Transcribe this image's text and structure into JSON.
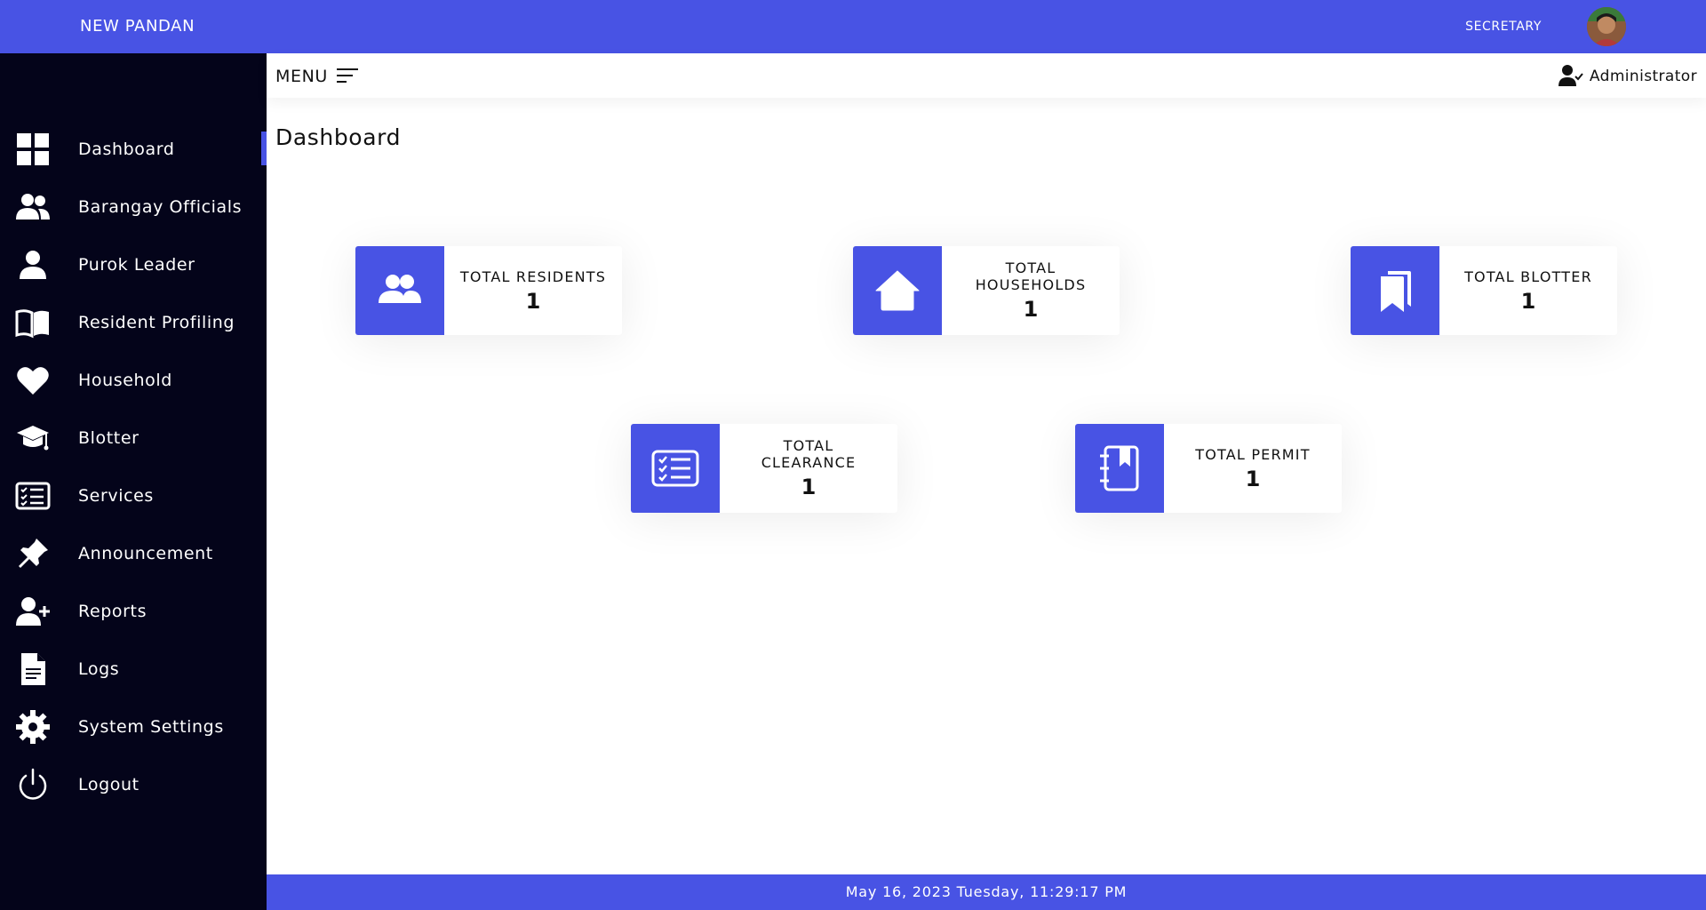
{
  "topbar": {
    "brand": "NEW PANDAN",
    "role": "SECRETARY"
  },
  "sidebar": {
    "items": [
      {
        "label": "Dashboard",
        "icon": "dashboard-grid-icon"
      },
      {
        "label": "Barangay Officials",
        "icon": "users-icon"
      },
      {
        "label": "Purok Leader",
        "icon": "user-icon"
      },
      {
        "label": "Resident Profiling",
        "icon": "book-icon"
      },
      {
        "label": "Household",
        "icon": "heart-icon"
      },
      {
        "label": "Blotter",
        "icon": "graduation-cap-icon"
      },
      {
        "label": "Services",
        "icon": "checklist-icon"
      },
      {
        "label": "Announcement",
        "icon": "pin-icon"
      },
      {
        "label": "Reports",
        "icon": "user-plus-icon"
      },
      {
        "label": "Logs",
        "icon": "file-icon"
      },
      {
        "label": "System Settings",
        "icon": "gear-icon"
      },
      {
        "label": "Logout",
        "icon": "power-icon"
      }
    ],
    "active": "Dashboard"
  },
  "subheader": {
    "menu_label": "MENU",
    "user_label": "Administrator"
  },
  "page": {
    "title": "Dashboard"
  },
  "cards": [
    {
      "label": "TOTAL RESIDENTS",
      "value": "1",
      "icon": "users-icon"
    },
    {
      "label": "TOTAL HOUSEHOLDS",
      "value": "1",
      "icon": "house-icon"
    },
    {
      "label": "TOTAL BLOTTER",
      "value": "1",
      "icon": "bookmarks-icon"
    },
    {
      "label": "TOTAL CLEARANCE",
      "value": "1",
      "icon": "checklist-icon"
    },
    {
      "label": "TOTAL PERMIT",
      "value": "1",
      "icon": "notebook-icon"
    }
  ],
  "footer": {
    "datetime": "May 16, 2023 Tuesday, 11:29:17 PM"
  },
  "colors": {
    "accent": "#4853e4",
    "sidebar_bg": "#04041a"
  }
}
